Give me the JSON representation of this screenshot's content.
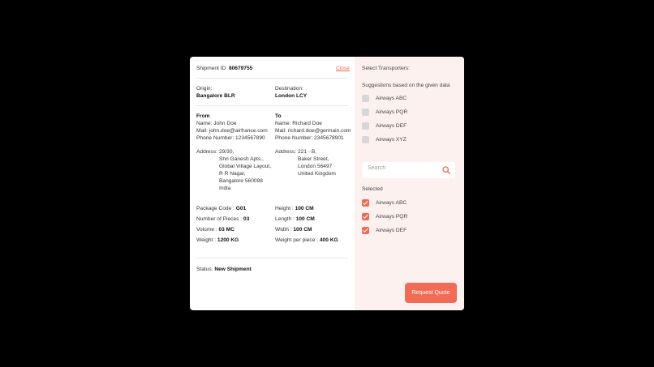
{
  "shipment": {
    "id_label": "Shipment ID:",
    "id_value": "80679755",
    "close_label": "Close"
  },
  "route": {
    "origin_label": "Origin:",
    "origin_value": "Bangalore BLR",
    "destination_label": "Destination:",
    "destination_value": "London LCY"
  },
  "from": {
    "heading": "From",
    "name": "Name: John Doe",
    "mail": "Mail: john.doe@airfrance.com",
    "phone": "Phone Number: 1234567890",
    "address_label": "Address:",
    "address_lines": [
      "29/30,",
      "Shri Ganesh Apts.,",
      "Global Village Layout,",
      "R R Nagar,",
      "Bangalore 560098",
      "India"
    ]
  },
  "to": {
    "heading": "To",
    "name": "Name: Richard Doe",
    "mail": "Mail: richard.doe@germain.com",
    "phone": "Phone Number: 2345678901",
    "address_label": "Address:",
    "address_lines": [
      "221 - B,",
      "Baker Street,",
      "London 56497",
      "United Kingdom"
    ]
  },
  "package": {
    "code_label": "Package Code :",
    "code_value": "G01",
    "pieces_label": "Number of Pieces :",
    "pieces_value": "03",
    "volume_label": "Volume :",
    "volume_value": "03 MC",
    "weight_label": "Weight :",
    "weight_value": "1200 KG",
    "height_label": "Height :",
    "height_value": "100 CM",
    "length_label": "Length :",
    "length_value": "100 CM",
    "width_label": "Width :",
    "width_value": "100 CM",
    "wpp_label": "Weight per piece :",
    "wpp_value": "400 KG"
  },
  "status": {
    "label": "Status:",
    "value": "New Shipment"
  },
  "transporters": {
    "title": "Select Transporters:",
    "suggestions_label": "Suggestions based on the given data",
    "suggestions": [
      {
        "name": "Airways ABC",
        "checked": false
      },
      {
        "name": "Airways PQR",
        "checked": false
      },
      {
        "name": "Airways DEF",
        "checked": false
      },
      {
        "name": "Airways XYZ",
        "checked": false
      }
    ],
    "search_placeholder": "Search",
    "selected_label": "Selected",
    "selected": [
      {
        "name": "Airways ABC",
        "checked": true
      },
      {
        "name": "Airways PQR",
        "checked": true
      },
      {
        "name": "Airways DEF",
        "checked": true
      }
    ],
    "request_button": "Request Quote"
  },
  "colors": {
    "accent": "#f26b55",
    "panel_bg": "#fdf1f0",
    "backdrop": "#000000"
  }
}
